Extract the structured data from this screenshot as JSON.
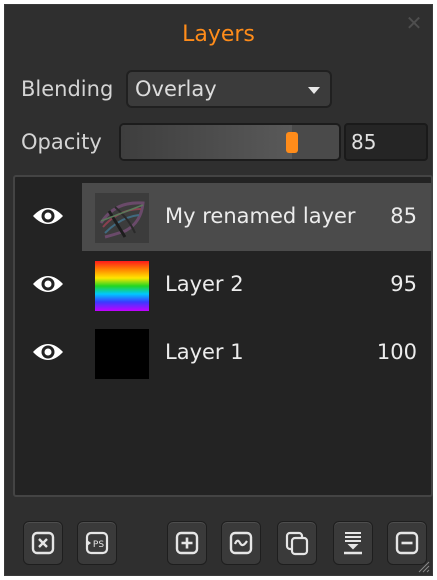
{
  "panel": {
    "title": "Layers",
    "close_icon": "close-icon",
    "accent_color": "#ff8c1a"
  },
  "blending": {
    "label": "Blending",
    "value": "Overlay",
    "icon": "chevron-down-icon"
  },
  "opacity": {
    "label": "Opacity",
    "value": "85",
    "fraction": 0.85
  },
  "layers": [
    {
      "name": "My renamed layer",
      "opacity": "85",
      "selected": true,
      "visible_icon": "eye-icon",
      "thumbnail": "sketch"
    },
    {
      "name": "Layer 2",
      "opacity": "95",
      "selected": false,
      "visible_icon": "eye-icon",
      "thumbnail": "rainbow"
    },
    {
      "name": "Layer 1",
      "opacity": "100",
      "selected": false,
      "visible_icon": "eye-icon",
      "thumbnail": "black"
    }
  ],
  "toolbar": {
    "buttons": [
      {
        "icon": "clear-layer-icon"
      },
      {
        "icon": "export-psd-icon",
        "text": "PS"
      },
      {
        "icon": "add-layer-icon"
      },
      {
        "icon": "wave-icon"
      },
      {
        "icon": "duplicate-layer-icon"
      },
      {
        "icon": "merge-down-icon"
      },
      {
        "icon": "delete-layer-icon"
      }
    ]
  }
}
